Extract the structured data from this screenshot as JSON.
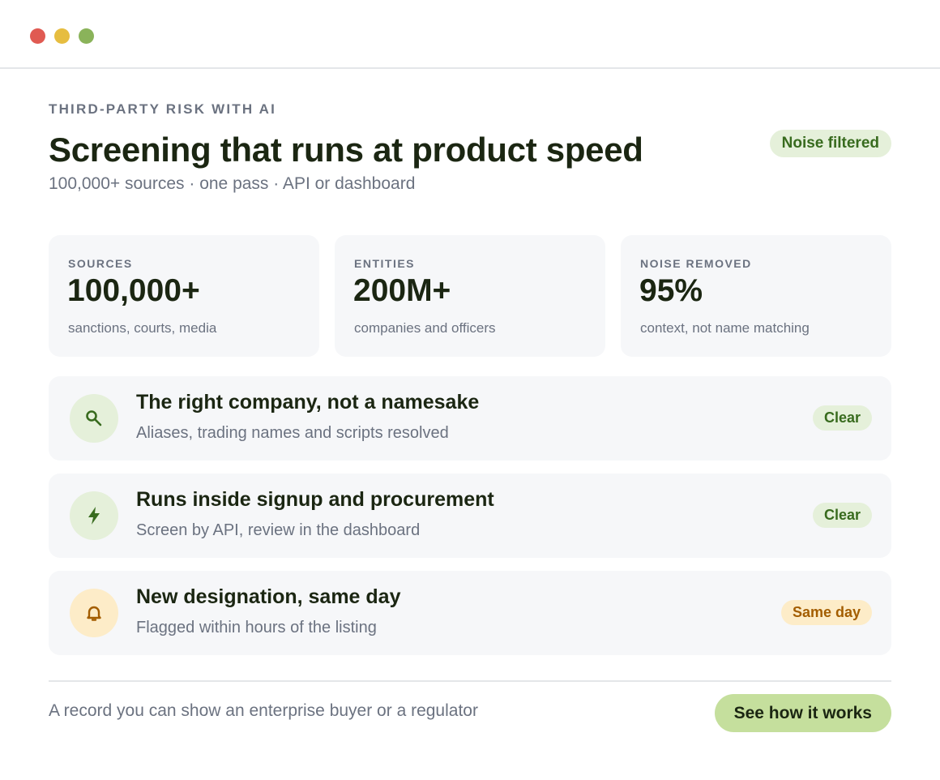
{
  "colors": {
    "accent_green": "#386b1e",
    "accent_green_bg": "#e5f0da",
    "accent_warm": "#a35d00",
    "accent_warm_bg": "#fdecc8",
    "cta_bg": "#c5df9d",
    "window_dots": [
      "#e05a52",
      "#e6bd40",
      "#8ab35a"
    ]
  },
  "header": {
    "eyebrow": "THIRD-PARTY RISK WITH AI",
    "title": "Screening that runs at product speed",
    "subtitle": "100,000+ sources · one pass · API or dashboard",
    "status_pill": "Noise filtered"
  },
  "stats": [
    {
      "label": "SOURCES",
      "value": "100,000+",
      "note": "sanctions, courts, media"
    },
    {
      "label": "ENTITIES",
      "value": "200M+",
      "note": "companies and officers"
    },
    {
      "label": "NOISE REMOVED",
      "value": "95%",
      "note": "context, not name matching"
    }
  ],
  "features": [
    {
      "icon": "search-icon",
      "title": "The right company, not a namesake",
      "description": "Aliases, trading names and scripts resolved",
      "badge": "Clear"
    },
    {
      "icon": "lightning-icon",
      "title": "Runs inside signup and procurement",
      "description": "Screen by API, review in the dashboard",
      "badge": "Clear"
    },
    {
      "icon": "bell-icon",
      "title": "New designation, same day",
      "description": "Flagged within hours of the listing",
      "badge": "Same day"
    }
  ],
  "footer": {
    "text": "A record you can show an enterprise buyer or a regulator",
    "cta_label": "See how it works"
  }
}
